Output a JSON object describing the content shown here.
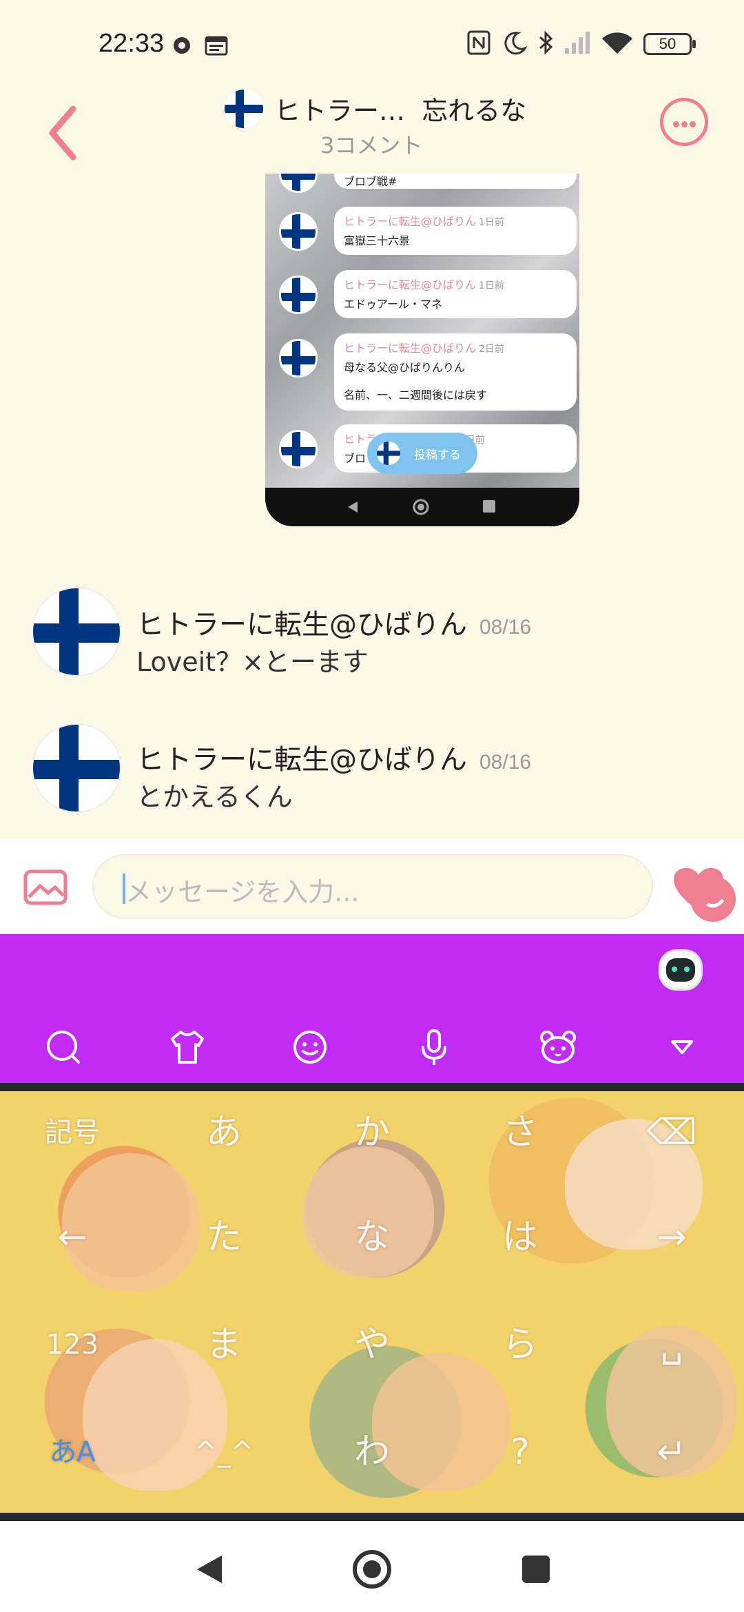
{
  "status_bar": {
    "time": "22:33",
    "battery": "50"
  },
  "header": {
    "title": "ヒトラー…",
    "title_suffix": "忘れるな",
    "subtitle": "3コメント"
  },
  "shared_screenshot": {
    "rows": [
      {
        "name": "",
        "ago": "",
        "lines": [
          "ブロブ戦#"
        ]
      },
      {
        "name": "ヒトラーに転生@ひばりん",
        "ago": "1日前",
        "lines": [
          "富嶽三十六景"
        ]
      },
      {
        "name": "ヒトラーに転生@ひばりん",
        "ago": "1日前",
        "lines": [
          "エドゥアール・マネ"
        ]
      },
      {
        "name": "ヒトラーに転生@ひばりん",
        "ago": "2日前",
        "lines": [
          "母なる父@ひばりんりん",
          "名前、一、二週間後には戻す"
        ]
      },
      {
        "name": "ヒトラ",
        "ago": "2日前",
        "lines": [
          "ブロッ"
        ]
      }
    ],
    "post_label": "投稿する"
  },
  "comments": [
    {
      "name": "ヒトラーに転生@ひばりん",
      "date": "08/16",
      "text": "Loveit？×とーます"
    },
    {
      "name": "ヒトラーに転生@ひばりん",
      "date": "08/16",
      "text": "とかえるくん"
    }
  ],
  "input": {
    "placeholder": "メッセージを入力..."
  },
  "keyboard": {
    "tools": [
      "search-icon",
      "shirt-icon",
      "smiley-icon",
      "mic-icon",
      "bear-icon",
      "collapse-icon"
    ],
    "keys": {
      "kigou": "記号",
      "a": "あ",
      "ka": "か",
      "sa": "さ",
      "backspace": "⌫",
      "left": "←",
      "ta": "た",
      "na": "な",
      "ha": "は",
      "right": "→",
      "num": "123",
      "ma": "ま",
      "ya": "や",
      "ra": "ら",
      "space": "␣",
      "kana": "あA",
      "face": "^_^",
      "wa": "わ",
      "punct": "?",
      "enter": "↵"
    }
  },
  "colors": {
    "accent_pink": "#ef7e92",
    "keyboard_bar": "#c12cf5",
    "background": "#fdf7e8",
    "flag_blue": "#003580"
  }
}
